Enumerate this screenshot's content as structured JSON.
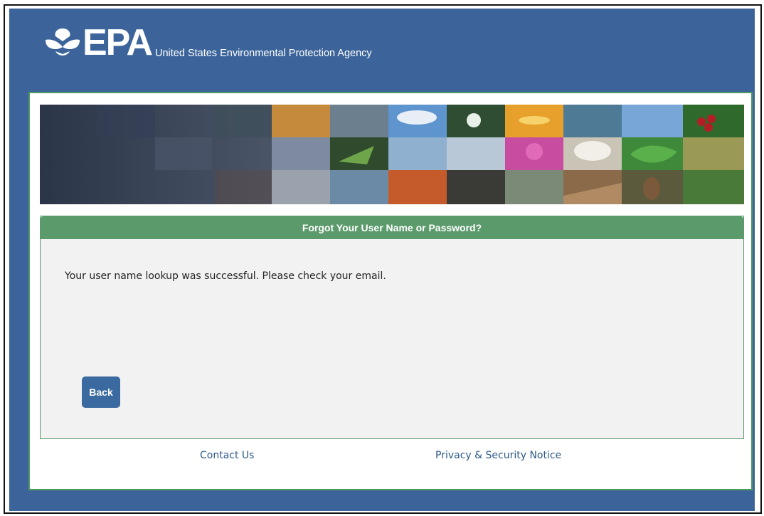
{
  "header": {
    "logo_text": "EPA",
    "agency_name": "United States Environmental Protection Agency",
    "logo_icon": "epa-flower-icon"
  },
  "banner": {
    "tile_colors": {
      "sky": "#5f95cf",
      "sunset": "#e7a02c",
      "leaf": "#3e8a3a",
      "flower": "#c84ca0",
      "berry": "#b31d24",
      "water": "#4f7a96"
    }
  },
  "panel": {
    "title": "Forgot Your User Name or Password?",
    "message": "Your user name lookup was successful. Please check your email.",
    "back_label": "Back"
  },
  "footer": {
    "contact_label": "Contact Us",
    "privacy_label": "Privacy & Security Notice"
  },
  "colors": {
    "page_blue": "#3c649a",
    "accent_green": "#5b9a6b",
    "button_blue": "#3a6aa0",
    "link_blue": "#2d5a87"
  }
}
